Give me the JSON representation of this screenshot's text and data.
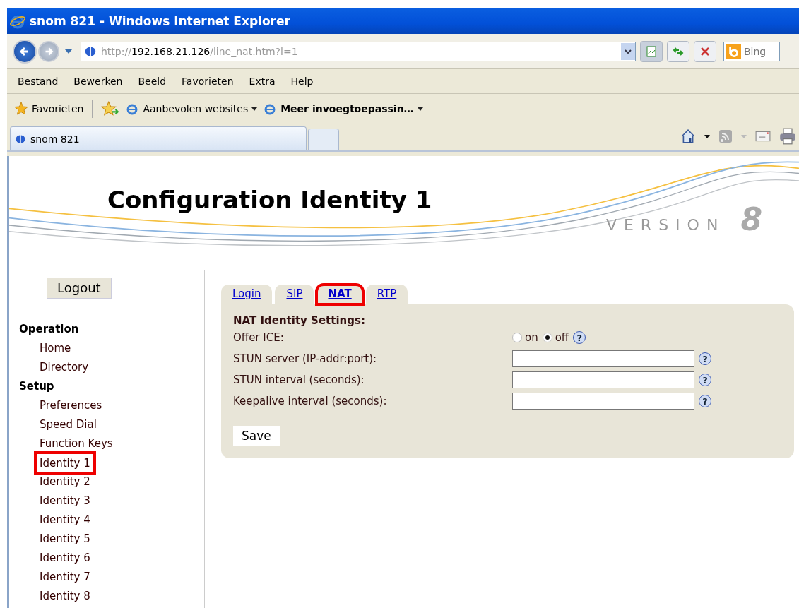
{
  "window": {
    "title": "snom 821 - Windows Internet Explorer"
  },
  "address_bar": {
    "scheme": "http://",
    "host": "192.168.21.126",
    "path": "/line_nat.htm?l=1"
  },
  "search": {
    "placeholder": "Bing"
  },
  "menu": [
    "Bestand",
    "Bewerken",
    "Beeld",
    "Favorieten",
    "Extra",
    "Help"
  ],
  "favorites_bar": {
    "favorites": "Favorieten",
    "items": [
      {
        "label": "Aanbevolen websites"
      },
      {
        "label": "Meer invoegtoepassin…"
      }
    ]
  },
  "browser_tabs": [
    {
      "label": "snom 821",
      "selected": true
    }
  ],
  "page": {
    "title": "Configuration Identity 1",
    "version_label": "VERSION",
    "version_number": "8",
    "logout": "Logout",
    "sidebar": [
      {
        "heading": "Operation",
        "items": [
          {
            "label": "Home",
            "highlighted": false
          },
          {
            "label": "Directory",
            "highlighted": false
          }
        ]
      },
      {
        "heading": "Setup",
        "items": [
          {
            "label": "Preferences",
            "highlighted": false
          },
          {
            "label": "Speed Dial",
            "highlighted": false
          },
          {
            "label": "Function Keys",
            "highlighted": false
          },
          {
            "label": "Identity 1",
            "highlighted": true
          },
          {
            "label": "Identity 2",
            "highlighted": false
          },
          {
            "label": "Identity 3",
            "highlighted": false
          },
          {
            "label": "Identity 4",
            "highlighted": false
          },
          {
            "label": "Identity 5",
            "highlighted": false
          },
          {
            "label": "Identity 6",
            "highlighted": false
          },
          {
            "label": "Identity 7",
            "highlighted": false
          },
          {
            "label": "Identity 8",
            "highlighted": false
          }
        ]
      }
    ],
    "tabs": [
      {
        "label": "Login",
        "selected": false,
        "highlighted": false
      },
      {
        "label": "SIP",
        "selected": false,
        "highlighted": false
      },
      {
        "label": "NAT",
        "selected": true,
        "highlighted": true
      },
      {
        "label": "RTP",
        "selected": false,
        "highlighted": false
      }
    ],
    "section_title": "NAT Identity Settings:",
    "settings": [
      {
        "kind": "radio",
        "label": "Offer ICE:",
        "options": [
          {
            "label": "on",
            "selected": false
          },
          {
            "label": "off",
            "selected": true
          }
        ],
        "help": "?"
      },
      {
        "kind": "text",
        "label": "STUN server (IP-addr:port):",
        "help": "?"
      },
      {
        "kind": "text",
        "label": "STUN interval (seconds):",
        "help": "?"
      },
      {
        "kind": "text",
        "label": "Keepalive interval (seconds):",
        "help": "?"
      }
    ],
    "save": "Save"
  }
}
